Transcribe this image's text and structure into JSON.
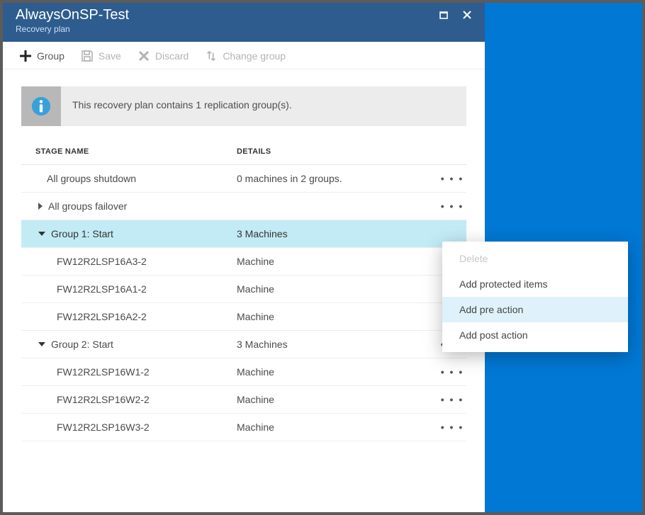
{
  "header": {
    "title": "AlwaysOnSP-Test",
    "subtitle": "Recovery plan"
  },
  "toolbar": {
    "group": "Group",
    "save": "Save",
    "discard": "Discard",
    "change_group": "Change group"
  },
  "info": {
    "text": "This recovery plan contains 1 replication group(s)."
  },
  "columns": {
    "name": "STAGE NAME",
    "details": "DETAILS"
  },
  "rows": {
    "shutdown": {
      "name": "All groups shutdown",
      "details": "0 machines in 2 groups."
    },
    "failover": {
      "name": "All groups failover",
      "details": ""
    },
    "group1": {
      "name": "Group 1: Start",
      "details": "3 Machines"
    },
    "g1m1": {
      "name": "FW12R2LSP16A3-2",
      "details": "Machine"
    },
    "g1m2": {
      "name": "FW12R2LSP16A1-2",
      "details": "Machine"
    },
    "g1m3": {
      "name": "FW12R2LSP16A2-2",
      "details": "Machine"
    },
    "group2": {
      "name": "Group 2: Start",
      "details": "3 Machines"
    },
    "g2m1": {
      "name": "FW12R2LSP16W1-2",
      "details": "Machine"
    },
    "g2m2": {
      "name": "FW12R2LSP16W2-2",
      "details": "Machine"
    },
    "g2m3": {
      "name": "FW12R2LSP16W3-2",
      "details": "Machine"
    }
  },
  "ellipsis": "• • •",
  "context_menu": {
    "delete": "Delete",
    "add_protected": "Add protected items",
    "add_pre": "Add pre action",
    "add_post": "Add post action"
  }
}
